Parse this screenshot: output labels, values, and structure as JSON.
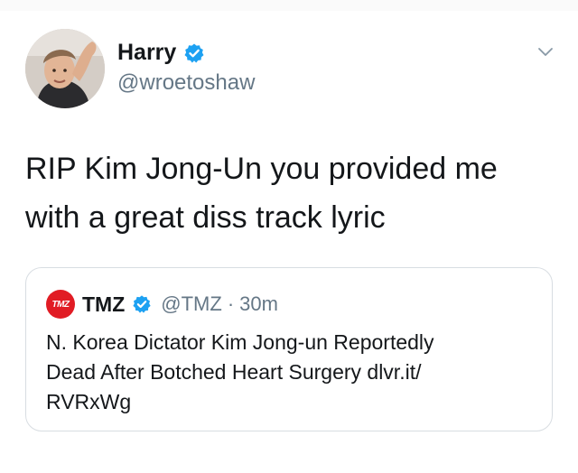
{
  "tweet": {
    "author": {
      "display_name": "Harry",
      "handle": "@wroetoshaw",
      "verified": true,
      "avatar_icon": "user-avatar"
    },
    "text_line_1": "RIP Kim Jong-Un you provided me",
    "text_line_2": "with a great diss track lyric",
    "menu_icon": "chevron-down-icon"
  },
  "quoted_tweet": {
    "logo_text": "TMZ",
    "display_name": "TMZ",
    "handle": "@TMZ",
    "separator": "·",
    "time": "30m",
    "verified": true,
    "text_line_1": "N. Korea Dictator Kim Jong-un Reportedly",
    "text_line_2": "Dead After Botched Heart Surgery dlvr.it/",
    "text_line_3": "RVRxWg"
  },
  "colors": {
    "verified_blue": "#1da1f2",
    "tmz_red": "#e11c24",
    "secondary_text": "#657786",
    "border": "#d8dde2"
  }
}
